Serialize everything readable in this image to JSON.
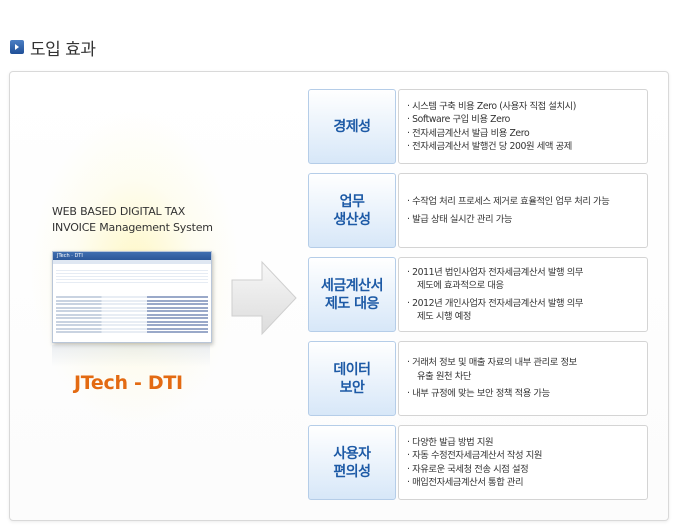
{
  "section": {
    "title": "도입 효과"
  },
  "left": {
    "system_line1": "WEB BASED DIGITAL TAX",
    "system_line2": "INVOICE  Management System",
    "product_name": "JTech - DTI",
    "screenshot_title": "JTech · DTI"
  },
  "colors": {
    "brand_orange": "#e36a12",
    "category_blue": "#1d5aa6",
    "box_border": "#b5cde8"
  },
  "benefits": [
    {
      "category": "경제성",
      "items": [
        "· 시스템 구축 비용 Zero (사용자 직접 설치시)",
        "· Software 구입 비용 Zero",
        "· 전자세금계산서 발급 비용 Zero",
        "· 전자세금계산서 발행건 당 200원 세액 공제"
      ]
    },
    {
      "category": "업무\n생산성",
      "items": [
        "· 수작업 처리 프로세스 제거로 효율적인 업무 처리 가능",
        "· 발급 상태 실시간 관리 가능"
      ]
    },
    {
      "category": "세금계산서\n제도 대응",
      "items": [
        "· 2011년 법인사업자 전자세금계산서 발행 의무\n  제도에 효과적으로 대응",
        "· 2012년 개인사업자 전자세금계산서 발행 의무\n  제도 시행 예정"
      ]
    },
    {
      "category": "데이터\n보안",
      "items": [
        "· 거래처 정보 및 매출 자료의 내부 관리로 정보\n  유출 원천 차단",
        "· 내부 규정에 맞는 보안 정책 적용 가능"
      ]
    },
    {
      "category": "사용자\n편의성",
      "items": [
        "· 다양한 발급 방법 지원",
        "· 자동 수정전자세금계산서 작성 지원",
        "· 자유로운 국세청 전송 시점 설정",
        "· 매입전자세금계산서 통합 관리"
      ]
    }
  ]
}
